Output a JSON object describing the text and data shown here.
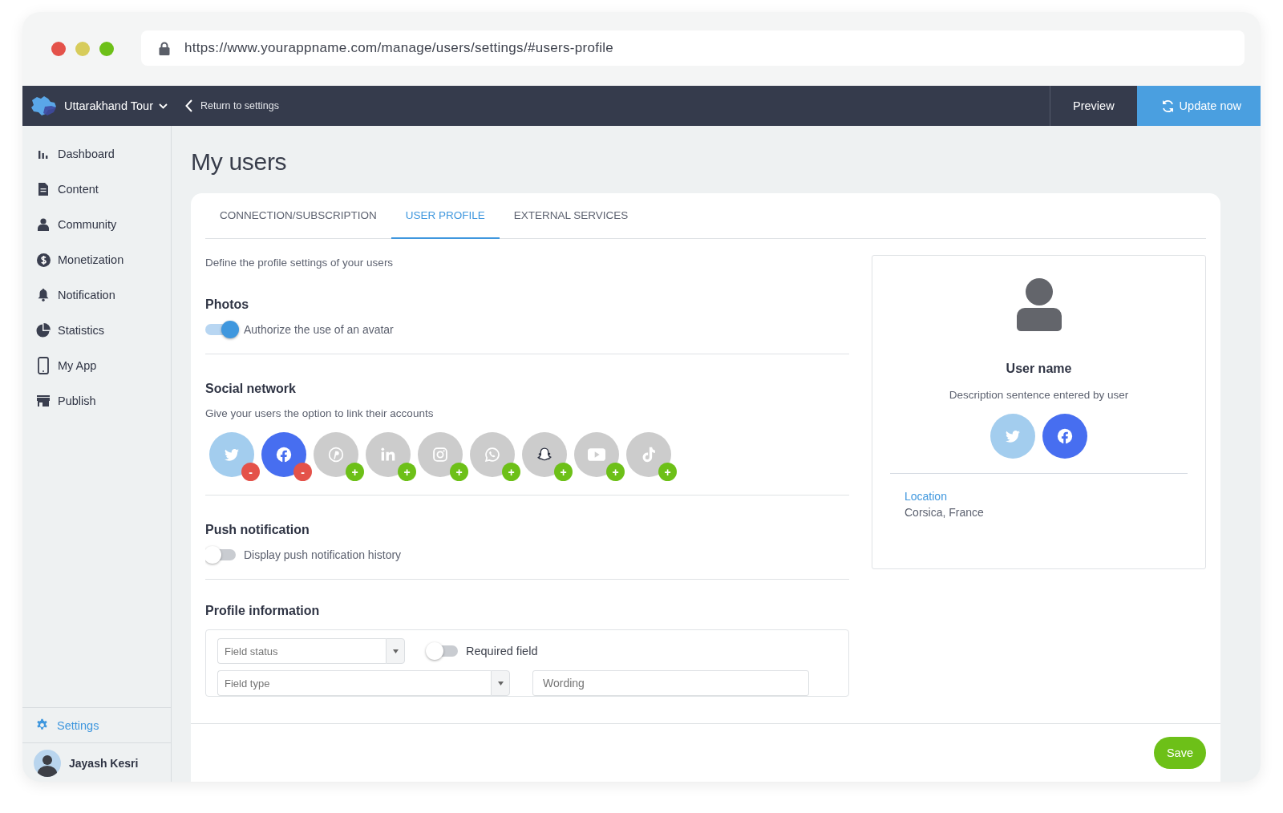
{
  "browser": {
    "url": "https://www.yourappname.com/manage/users/settings/#users-profile"
  },
  "header": {
    "app_name": "Uttarakhand Tour",
    "back_link": "Return to settings",
    "preview": "Preview",
    "update": "Update now"
  },
  "sidebar": {
    "items": [
      {
        "label": "Dashboard",
        "kind": "chart"
      },
      {
        "label": "Content",
        "kind": "document"
      },
      {
        "label": "Community",
        "kind": "person"
      },
      {
        "label": "Monetization",
        "kind": "dollar"
      },
      {
        "label": "Notification",
        "kind": "bell"
      },
      {
        "label": "Statistics",
        "kind": "pie"
      },
      {
        "label": "My App",
        "kind": "phone"
      },
      {
        "label": "Publish",
        "kind": "store"
      }
    ],
    "settings": {
      "label": "Settings",
      "selected": true
    },
    "user": "Jayash Kesri"
  },
  "page": {
    "title": "My users"
  },
  "tabs": [
    {
      "label": "CONNECTION/SUBSCRIPTION",
      "selected": false
    },
    {
      "label": "USER PROFILE",
      "selected": true
    },
    {
      "label": "EXTERNAL SERVICES",
      "selected": false
    }
  ],
  "intro": "Define the profile settings of your users",
  "photos": {
    "title": "Photos",
    "toggle": {
      "label": "Authorize the use of an avatar",
      "on": true
    }
  },
  "social": {
    "title": "Social network",
    "subtitle": "Give your users the option to link their accounts",
    "networks": [
      {
        "kind": "twitter",
        "linked": true,
        "badge": "-"
      },
      {
        "kind": "facebook",
        "linked": true,
        "badge": "-"
      },
      {
        "kind": "pinterest",
        "linked": false,
        "badge": "+"
      },
      {
        "kind": "linkedin",
        "linked": false,
        "badge": "+"
      },
      {
        "kind": "instagram",
        "linked": false,
        "badge": "+"
      },
      {
        "kind": "whatsapp",
        "linked": false,
        "badge": "+"
      },
      {
        "kind": "snapchat",
        "linked": false,
        "badge": "+"
      },
      {
        "kind": "youtube",
        "linked": false,
        "badge": "+"
      },
      {
        "kind": "tiktok",
        "linked": false,
        "badge": "+"
      }
    ]
  },
  "push": {
    "title": "Push notification",
    "toggle": {
      "label": "Display push notification history",
      "on": false
    }
  },
  "profile_info": {
    "title": "Profile information",
    "field_status": {
      "placeholder": "Field status"
    },
    "required": {
      "label": "Required field",
      "on": false
    },
    "field_type": {
      "placeholder": "Field type"
    },
    "wording": {
      "placeholder": "Wording"
    }
  },
  "preview_card": {
    "user_name": "User name",
    "description": "Description sentence entered by user",
    "networks": [
      {
        "kind": "twitter"
      },
      {
        "kind": "facebook"
      }
    ],
    "location_label": "Location",
    "location": "Corsica, France"
  },
  "save": "Save"
}
